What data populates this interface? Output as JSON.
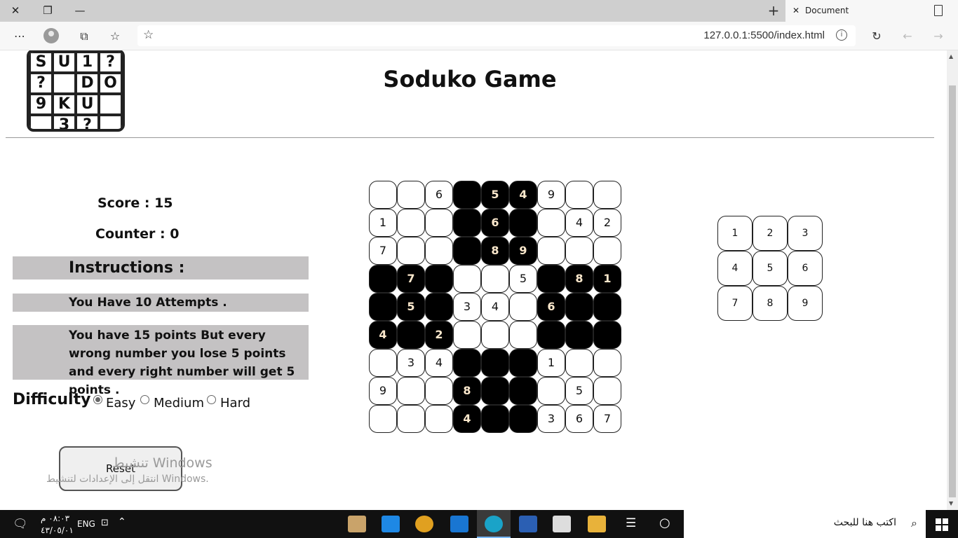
{
  "browser": {
    "tab_title": "Document",
    "url": "127.0.0.1:5500/index.html"
  },
  "page": {
    "logo_letters": [
      "S",
      "U",
      "1",
      "?",
      "?",
      "",
      "D",
      "O",
      "9",
      "K",
      "U",
      "",
      "",
      "3",
      "?",
      ""
    ],
    "title": "Soduko Game",
    "score_label": "Score : 15",
    "counter_label": "Counter : 0",
    "instructions_heading": "Instructions :",
    "attempts_text": "You Have 10 Attempts .",
    "rules_text": "You have 15 points But every wrong number you lose 5 points and every right number will get 5 points .",
    "difficulty_label": "Difficulty",
    "difficulty_options": [
      {
        "label": "Easy",
        "selected": true
      },
      {
        "label": "Medium",
        "selected": false
      },
      {
        "label": "Hard",
        "selected": false
      }
    ],
    "reset_label": "Reset",
    "board": [
      [
        "",
        "",
        "6",
        "#",
        "#5",
        "#4",
        "9",
        "",
        ""
      ],
      [
        "1",
        "",
        "",
        "#",
        "#6",
        "#",
        "",
        "4",
        "2"
      ],
      [
        "7",
        "",
        "",
        "#",
        "#8",
        "#9",
        "",
        "",
        ""
      ],
      [
        "#",
        "#7",
        "#",
        "",
        "",
        "5",
        "#",
        "#8",
        "#1"
      ],
      [
        "#",
        "#5",
        "#",
        "3",
        "4",
        "",
        "#6",
        "#",
        "#"
      ],
      [
        "#4",
        "#",
        "#2",
        "",
        "",
        "",
        "#",
        "#",
        "#"
      ],
      [
        "",
        "3",
        "4",
        "#",
        "#",
        "#",
        "1",
        "",
        ""
      ],
      [
        "9",
        "",
        "",
        "#8",
        "#",
        "#",
        "",
        "5",
        ""
      ],
      [
        "",
        "",
        "",
        "#4",
        "#",
        "#",
        "3",
        "6",
        "7"
      ]
    ],
    "number_pad": [
      "1",
      "2",
      "3",
      "4",
      "5",
      "6",
      "7",
      "8",
      "9"
    ]
  },
  "watermark": {
    "line1": "تنشيط Windows",
    "line2": "انتقل إلى الإعدادات لتنشيط Windows."
  },
  "taskbar": {
    "search_placeholder": "اكتب هنا للبحث",
    "language": "ENG",
    "time": "٠٨:٠٣ م",
    "date": "٤٣/٠٥/٠١"
  }
}
